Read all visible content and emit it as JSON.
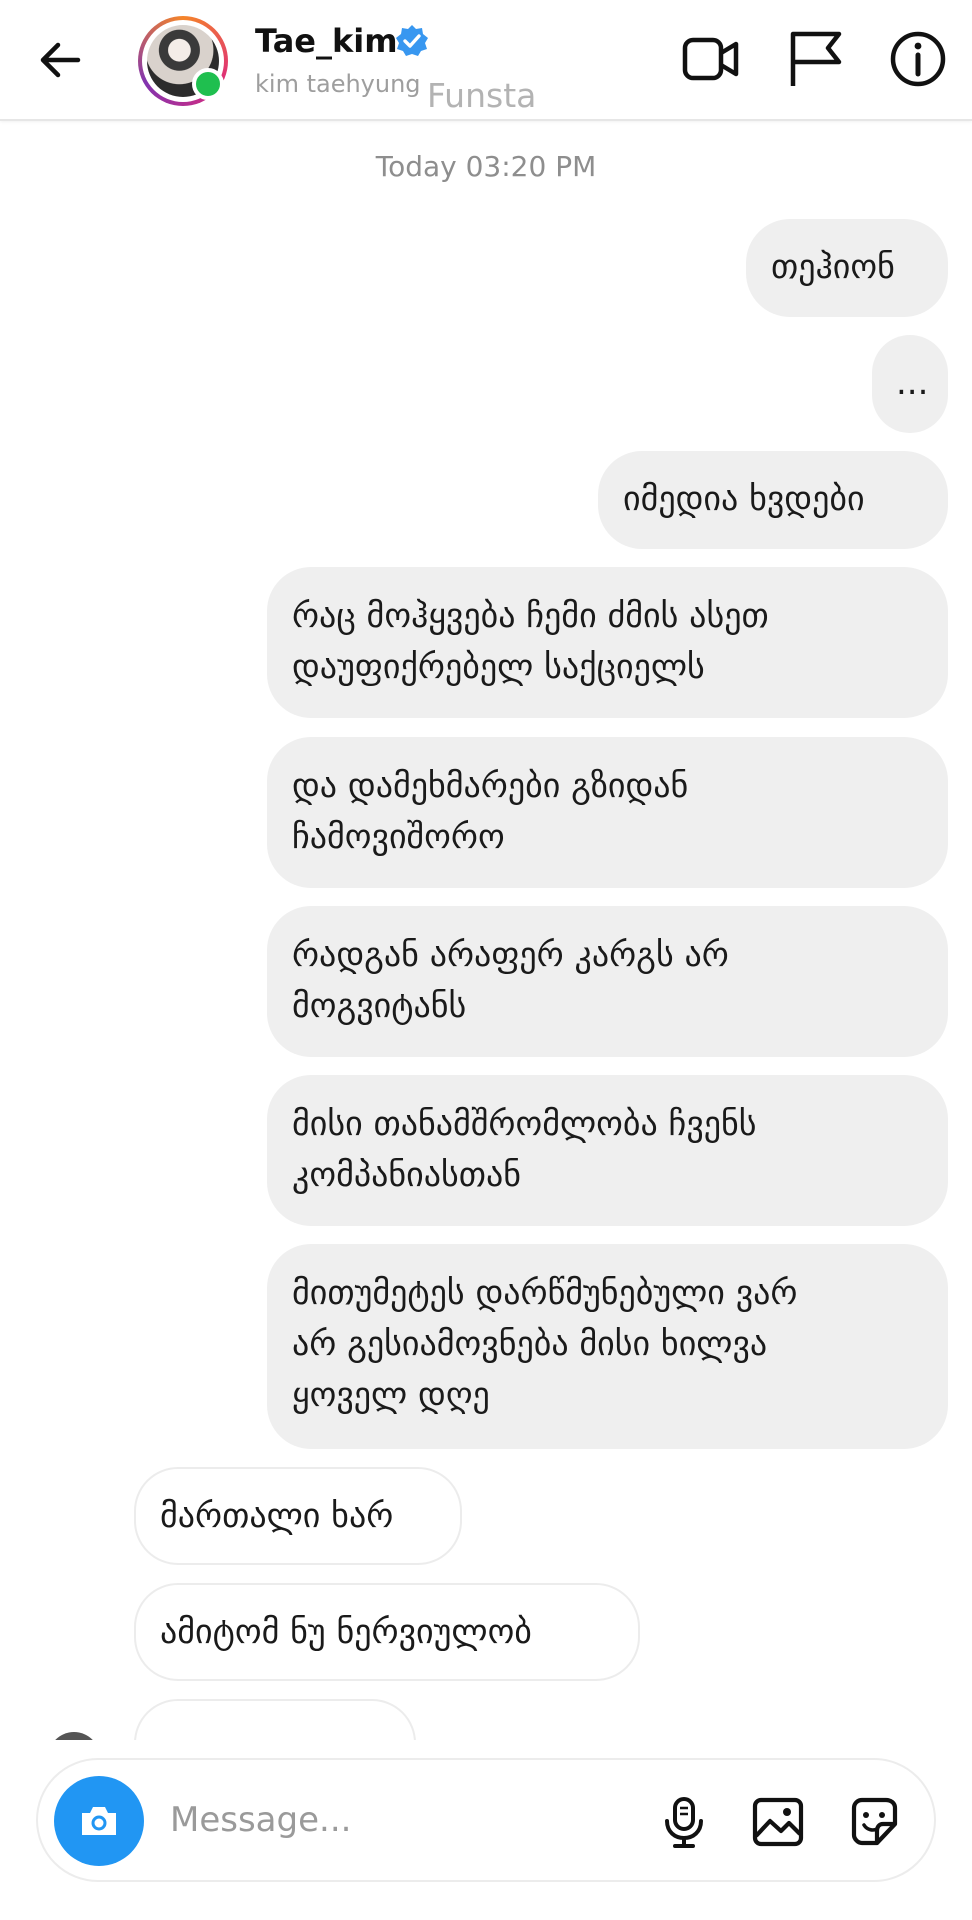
{
  "header": {
    "username": "Tae_kim",
    "display_name": "kim taehyung",
    "watermark": "Funsta",
    "icons": [
      "back-arrow-icon",
      "verified-badge-icon",
      "video-call-icon",
      "flag-icon",
      "info-icon"
    ]
  },
  "chat": {
    "timestamp": "Today 03:20 PM",
    "messages": [
      {
        "side": "sent",
        "text": "თეჰიონ"
      },
      {
        "side": "sent",
        "text": "..."
      },
      {
        "side": "sent",
        "text": "იმედია ხვდები"
      },
      {
        "side": "sent",
        "text": "რაც მოჰყვება ჩემი ძმის ასეთ\nდაუფიქრებელ საქციელს"
      },
      {
        "side": "sent",
        "text": "და დამეხმარები გზიდან\nჩამოვიშორო"
      },
      {
        "side": "sent",
        "text": "რადგან არაფერ კარგს არ\nმოგვიტანს"
      },
      {
        "side": "sent",
        "text": "მისი თანამშრომლობა ჩვენს\nკომპანიასთან"
      },
      {
        "side": "sent",
        "text": "მითუმეტეს დარწმუნებული ვარ\nარ გესიამოვნება მისი ხილვა\nყოველ დღე"
      },
      {
        "side": "received",
        "text": "მართალი ხარ"
      },
      {
        "side": "received",
        "text": "ამიტომ ნუ ნერვიულობ"
      }
    ]
  },
  "composer": {
    "placeholder": "Message...",
    "icons": [
      "camera-icon",
      "microphone-icon",
      "gallery-icon",
      "sticker-icon"
    ]
  },
  "colors": {
    "sent_bubble": "#efefef",
    "camera_button": "#2196f3",
    "verified": "#3897f0",
    "online": "#1fbf4f"
  }
}
